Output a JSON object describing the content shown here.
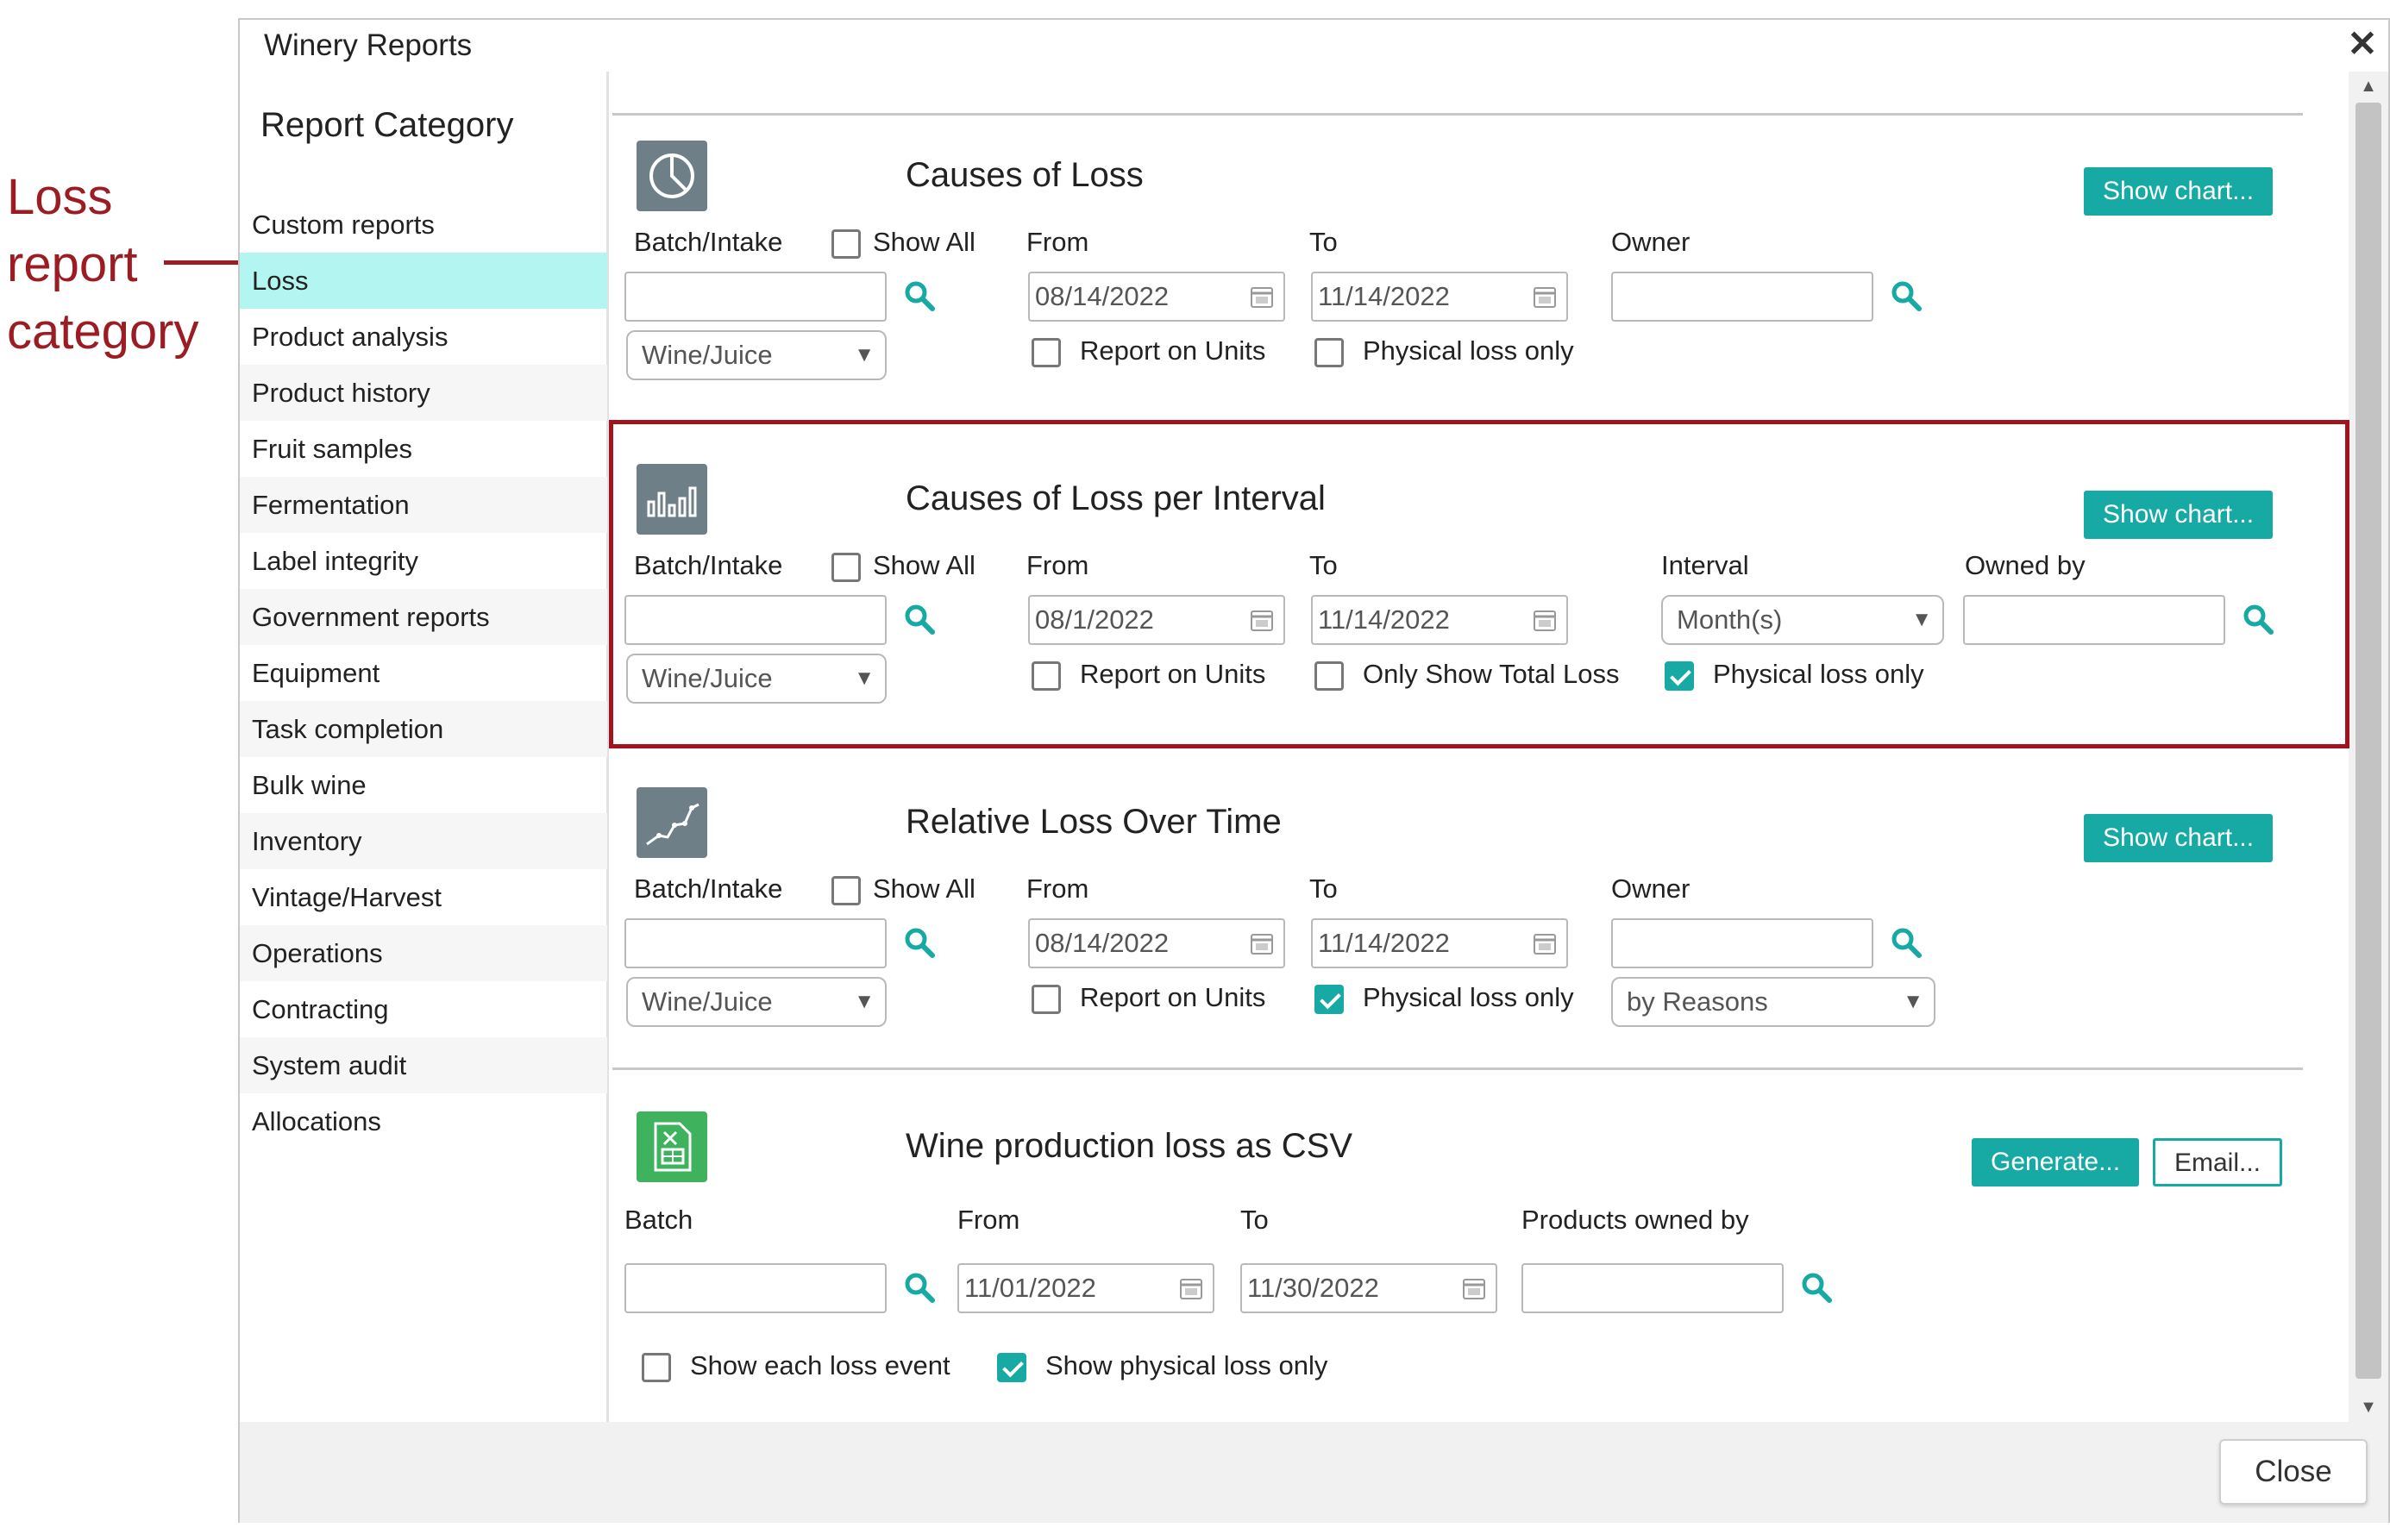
{
  "annotation": {
    "lines": [
      "Loss",
      "report",
      "category"
    ]
  },
  "dialog": {
    "title": "Winery Reports",
    "close_label": "Close"
  },
  "sidebar": {
    "title": "Report Category",
    "items": [
      {
        "label": "Custom reports"
      },
      {
        "label": "Loss",
        "selected": true
      },
      {
        "label": "Product analysis"
      },
      {
        "label": "Product history"
      },
      {
        "label": "Fruit samples"
      },
      {
        "label": "Fermentation"
      },
      {
        "label": "Label integrity"
      },
      {
        "label": "Government reports"
      },
      {
        "label": "Equipment"
      },
      {
        "label": "Task completion"
      },
      {
        "label": "Bulk wine"
      },
      {
        "label": "Inventory"
      },
      {
        "label": "Vintage/Harvest"
      },
      {
        "label": "Operations"
      },
      {
        "label": "Contracting"
      },
      {
        "label": "System audit"
      },
      {
        "label": "Allocations"
      }
    ]
  },
  "sections": [
    {
      "title": "Causes of Loss",
      "icon": "pie-chart-icon",
      "button": "Show chart...",
      "batch_label": "Batch/Intake",
      "show_all": "Show All",
      "from_label": "From",
      "from_value": "08/14/2022",
      "to_label": "To",
      "to_value": "11/14/2022",
      "owner_label": "Owner",
      "product_type": "Wine/Juice",
      "report_units": "Report on Units",
      "physical_loss": "Physical loss only"
    },
    {
      "title": "Causes of Loss per Interval",
      "icon": "bar-chart-icon",
      "button": "Show chart...",
      "batch_label": "Batch/Intake",
      "show_all": "Show All",
      "from_label": "From",
      "from_value": "08/1/2022",
      "to_label": "To",
      "to_value": "11/14/2022",
      "interval_label": "Interval",
      "interval_value": "Month(s)",
      "owner_label": "Owned by",
      "product_type": "Wine/Juice",
      "report_units": "Report on Units",
      "total_loss": "Only Show Total Loss",
      "physical_loss": "Physical loss only"
    },
    {
      "title": "Relative Loss Over Time",
      "icon": "line-chart-icon",
      "button": "Show chart...",
      "batch_label": "Batch/Intake",
      "show_all": "Show All",
      "from_label": "From",
      "from_value": "08/14/2022",
      "to_label": "To",
      "to_value": "11/14/2022",
      "owner_label": "Owner",
      "product_type": "Wine/Juice",
      "report_units": "Report on Units",
      "physical_loss": "Physical loss only",
      "group_value": "by Reasons"
    },
    {
      "title": "Wine production loss as CSV",
      "icon": "spreadsheet-icon",
      "generate": "Generate...",
      "email": "Email...",
      "batch_label": "Batch",
      "from_label": "From",
      "from_value": "11/01/2022",
      "to_label": "To",
      "to_value": "11/30/2022",
      "owner_label": "Products owned by",
      "each_event": "Show each loss event",
      "physical_loss": "Show physical loss only"
    }
  ],
  "colors": {
    "accent": "#17a9a3",
    "highlight": "#a0131f",
    "selected": "#b3f6f1",
    "icon_gray": "#6e7f88",
    "icon_green": "#3fb25d"
  }
}
